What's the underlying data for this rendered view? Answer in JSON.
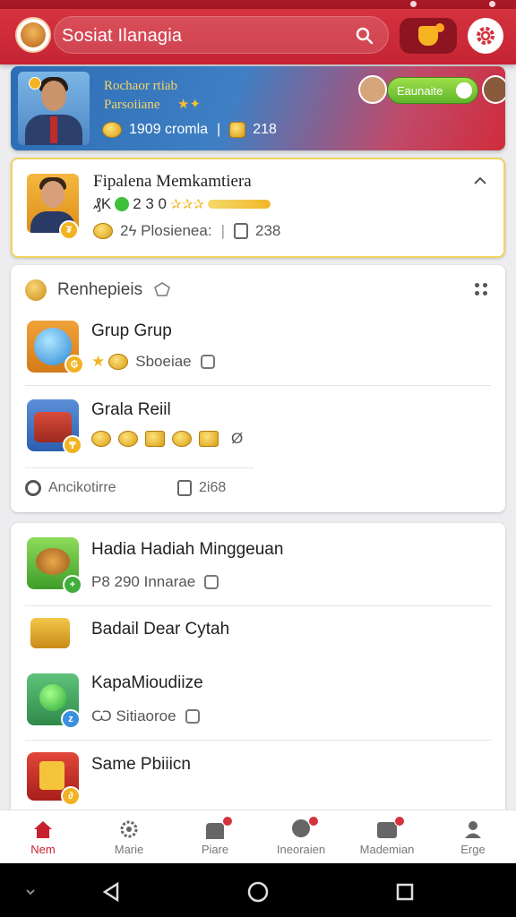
{
  "app": {
    "title": "Sosiat Ilanagia"
  },
  "hero": {
    "name": "Rochaor rtiab",
    "subtitle": "Parsoiiane",
    "stars": "★✦",
    "coins_value": "1909 cromla",
    "gems_value": "218",
    "action_label": "Eaunaite"
  },
  "profile": {
    "name": "Fipalena Memkamtiera",
    "level_prefix": "₰K",
    "level_value": "2 3 0",
    "level_stars": "✰✰✰",
    "coins_value": "2ϟ Plosienea:",
    "docs_value": "238"
  },
  "rewards": {
    "title": "Renhepieis",
    "items": [
      {
        "title": "Grup Grup",
        "meta": "Sboeiae"
      },
      {
        "title": "Grala Reiil",
        "meta": "Ø"
      }
    ],
    "footer_left": "Ancikotirre",
    "footer_right": "2i68"
  },
  "list": {
    "items": [
      {
        "title": "Hadia Hadiah Minggeuan",
        "meta": "P8 290 Innarae"
      },
      {
        "title": "Badail Dear Cytah",
        "meta": ""
      },
      {
        "title": "KapaMioudiize",
        "meta": "Ѡ Sitiaoroe"
      },
      {
        "title": "Same Pbiiicn",
        "meta": ""
      }
    ]
  },
  "nav": {
    "items": [
      {
        "label": "Nem",
        "icon": "home-icon"
      },
      {
        "label": "Marie",
        "icon": "gear-icon"
      },
      {
        "label": "Piare",
        "icon": "store-icon"
      },
      {
        "label": "Ineoraien",
        "icon": "info-icon"
      },
      {
        "label": "Mademian",
        "icon": "inbox-icon"
      },
      {
        "label": "Erge",
        "icon": "group-icon"
      }
    ]
  },
  "colors": {
    "primary": "#c8202e",
    "accent_gold": "#f2b322",
    "accent_green": "#5fb52a"
  }
}
